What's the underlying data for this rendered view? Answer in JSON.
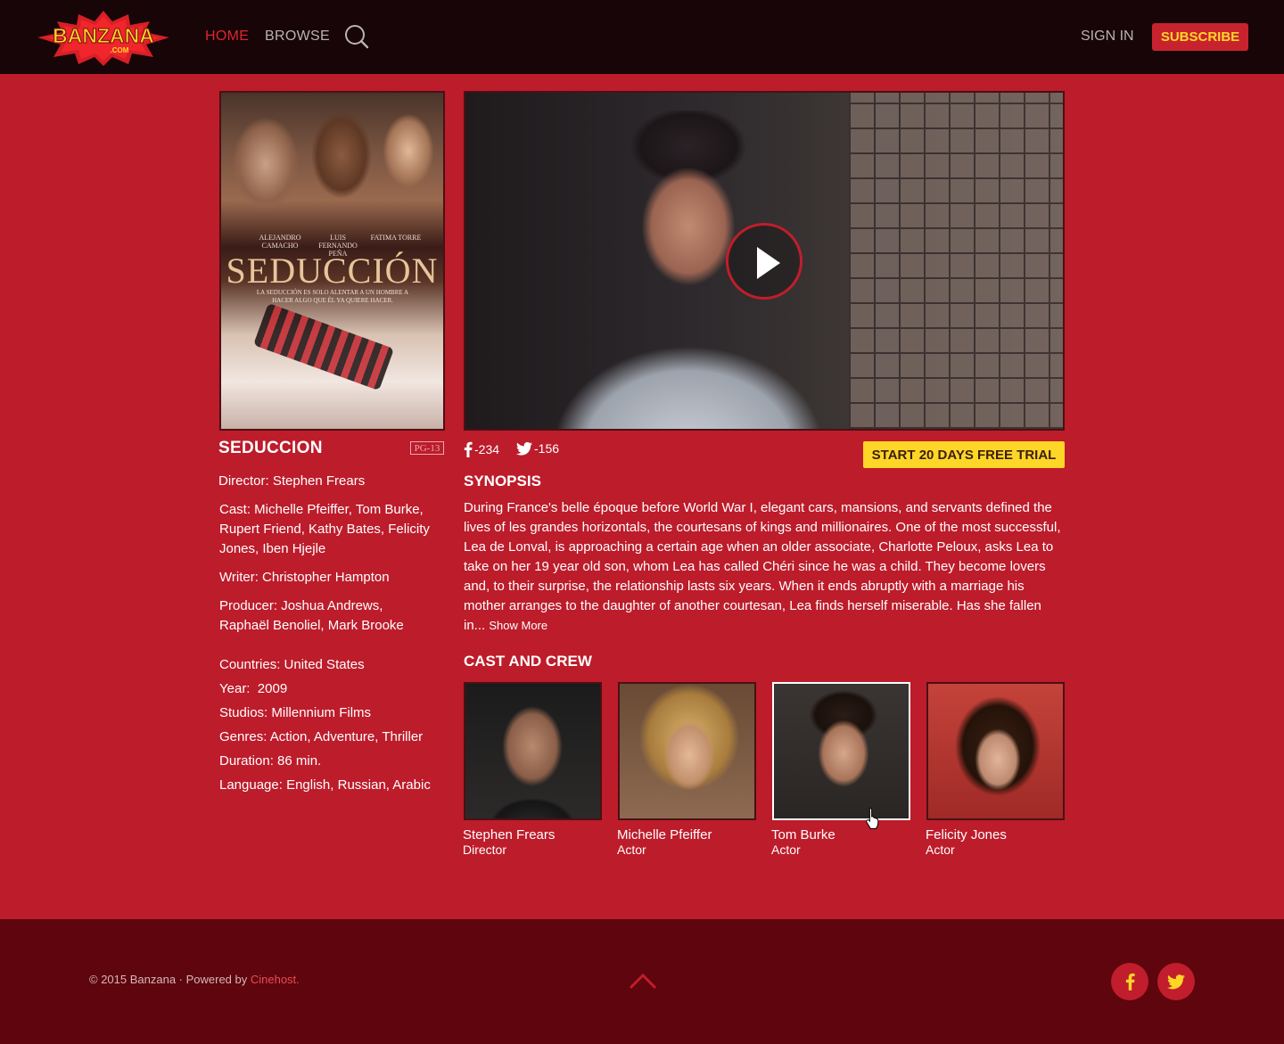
{
  "header": {
    "logo_text": "BANZANA",
    "logo_sub": ".COM",
    "nav": {
      "home": "HOME",
      "browse": "BROWSE"
    },
    "sign_in": "SIGN IN",
    "subscribe": "SUBSCRIBE"
  },
  "poster": {
    "credits": [
      "ALEJANDRO CAMACHO",
      "LUIS FERNANDO PEÑA",
      "FATIMA TORRE"
    ],
    "title": "SEDUCCIÓN",
    "tagline": "LA SEDUCCIÓN ES SOLO ALENTAR A UN HOMBRE A HACER ALGO QUE ÉL YA QUIERE HACER."
  },
  "movie": {
    "title": "SEDUCCION",
    "rating": "PG-13",
    "director": "Director: Stephen Frears",
    "cast": "Cast: Michelle Pfeiffer, Tom Burke, Rupert Friend, Kathy Bates, Felicity Jones, Iben Hjejle",
    "writer": "Writer: Christopher Hampton",
    "producer": "Producer: Joshua Andrews, Raphaël Benoliel, Mark Brooke",
    "countries": "Countries: United States",
    "year": "Year:  2009",
    "studios": "Studios: Millennium Films",
    "genres": "Genres: Action, Adventure, Thriller",
    "duration": "Duration: 86 min.",
    "language": "Language: English, Russian, Arabic"
  },
  "social": {
    "facebook_count": "-234",
    "twitter_count": "-156"
  },
  "trial_button": "START 20 DAYS FREE TRIAL",
  "synopsis": {
    "heading": "SYNOPSIS",
    "text": "During France's belle époque before World War I, elegant cars, mansions, and servants defined the lives of les grandes horizontals, the courtesans of kings and millionaires. One of the most successful, Lea de Lonval, is approaching a certain age when an older associate, Charlotte Peloux, asks Lea to take on her 19 year old son, whom Lea has called Chéri since he was a child. They become lovers and, to their surprise, the relationship lasts six years. When it ends abruptly with a marriage his mother arranges to the daughter of another courtesan, Lea finds herself mis­erable. Has she fallen in... ",
    "show_more": "Show More"
  },
  "cast_section": {
    "heading": "CAST AND CREW",
    "members": [
      {
        "name": "Stephen Frears",
        "role": "Director"
      },
      {
        "name": "Michelle Pfeiffer",
        "role": "Actor"
      },
      {
        "name": "Tom Burke",
        "role": "Actor"
      },
      {
        "name": "Felicity Jones",
        "role": "Actor"
      }
    ]
  },
  "footer": {
    "copyright": "© 2015 Banzana · Powered by ",
    "powered_link": "Cinehost."
  },
  "colors": {
    "background": "#bd1c2b",
    "header": "#170507",
    "footer": "#5e050d",
    "accent_yellow": "#fdd627",
    "active_nav": "#e0252f"
  },
  "icons": [
    "search-icon",
    "play-icon",
    "facebook-icon",
    "twitter-icon",
    "chevron-up-icon",
    "cursor-hand-icon"
  ]
}
